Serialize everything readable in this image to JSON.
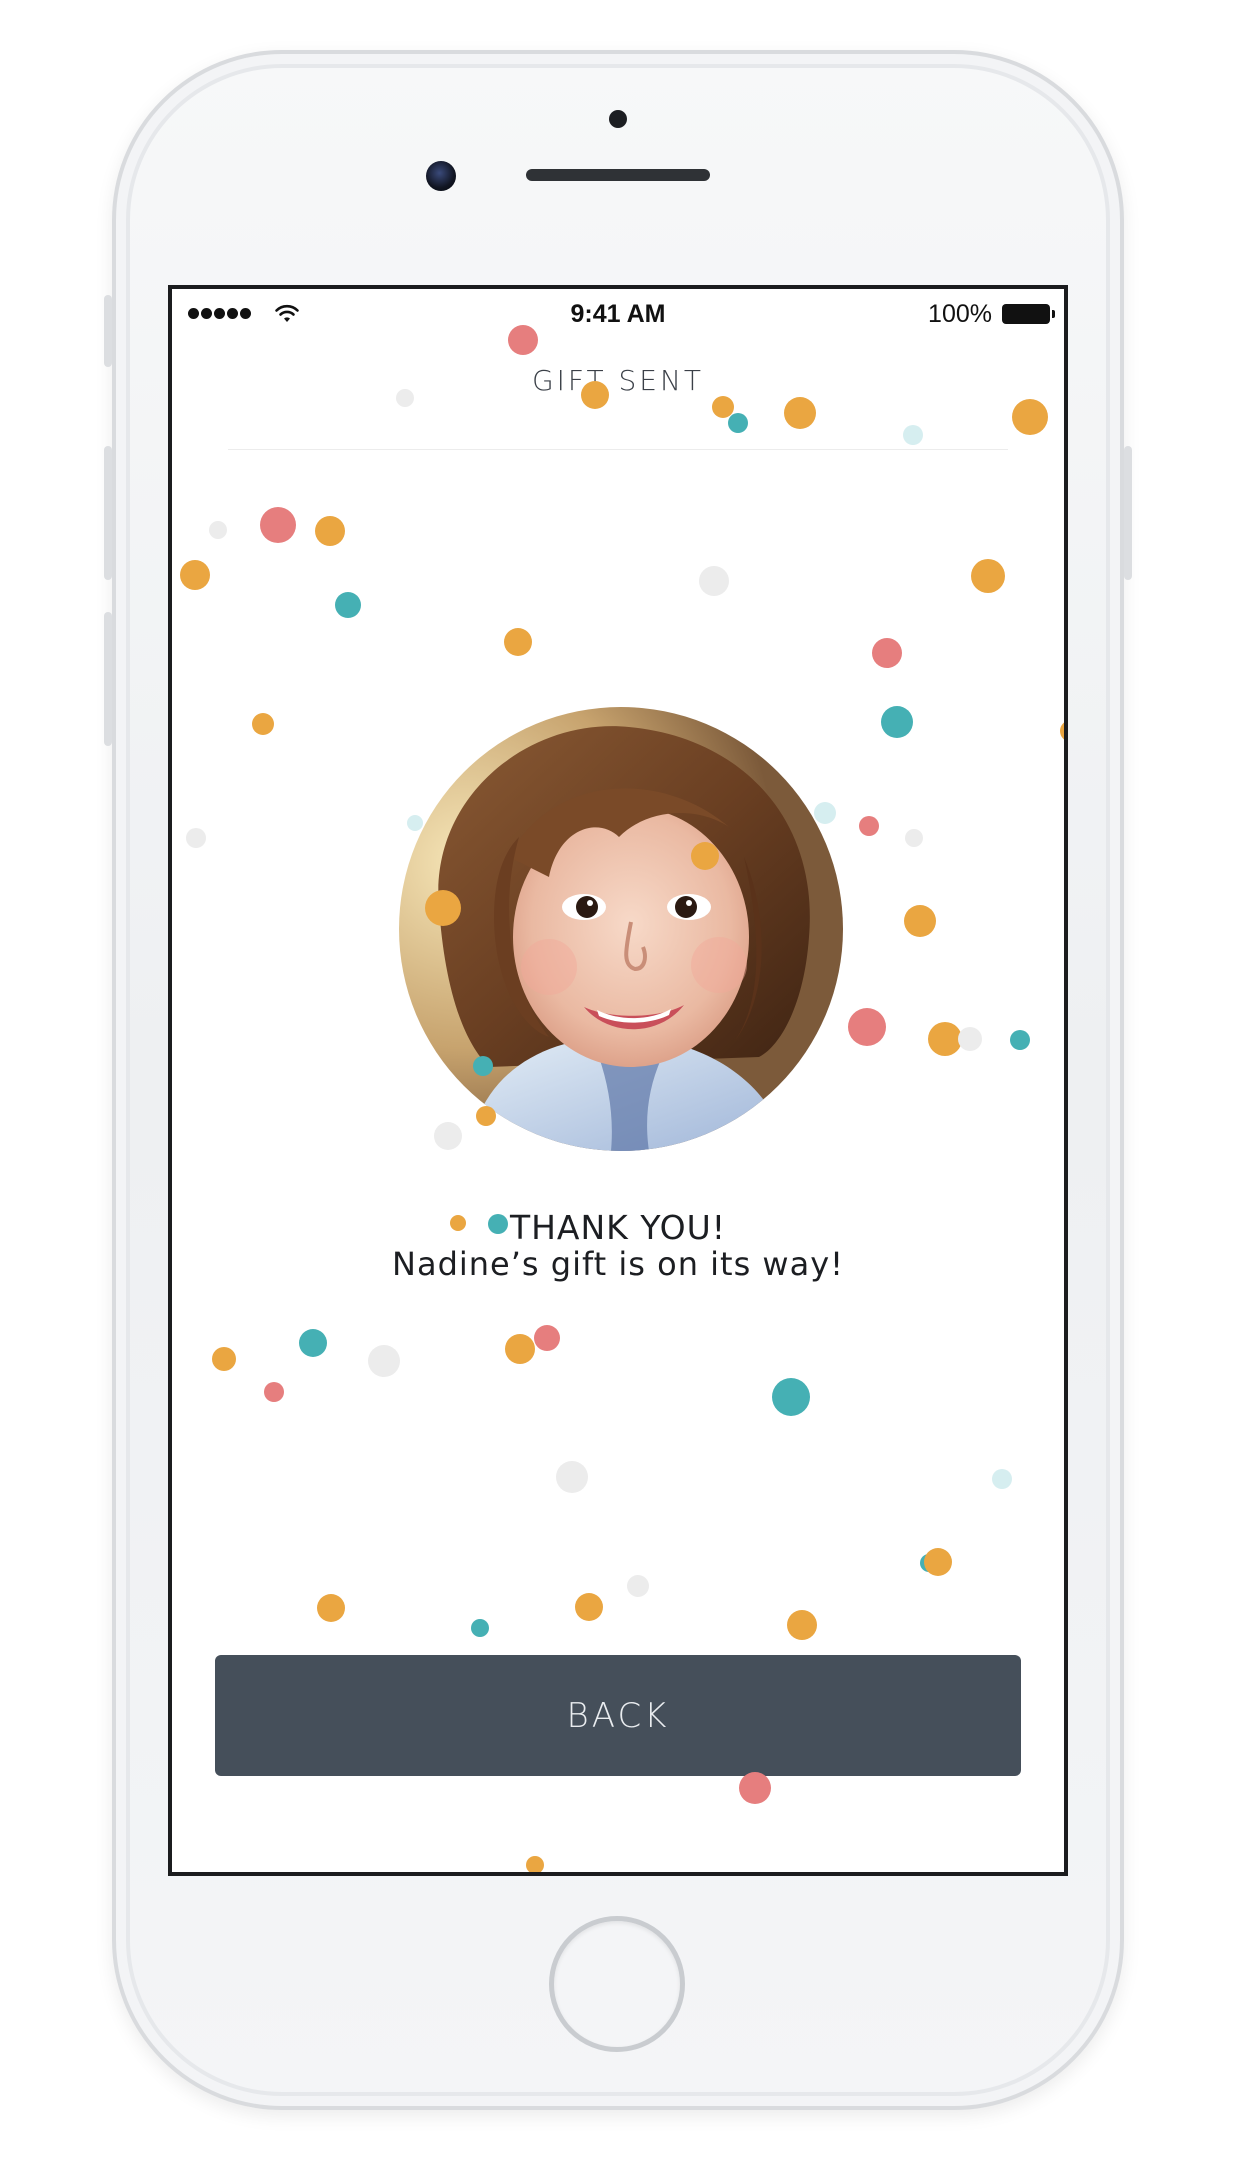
{
  "status_bar": {
    "time": "9:41 AM",
    "battery_percent": "100%",
    "signal_bars": 5,
    "wifi_icon": "wifi-icon"
  },
  "header": {
    "title": "GIFT SENT"
  },
  "confirmation": {
    "heading": "THANK YOU!",
    "message": "Nadine’s gift is on its way!",
    "photo": "child-photo"
  },
  "actions": {
    "back_label": "BACK"
  },
  "colors": {
    "button_bg": "#454f5a",
    "confetti_orange": "#eaa641",
    "confetti_pink": "#e67e7e",
    "confetti_teal": "#45b0b4",
    "confetti_grey": "#ececec",
    "confetti_light_teal": "#d6eef0"
  }
}
